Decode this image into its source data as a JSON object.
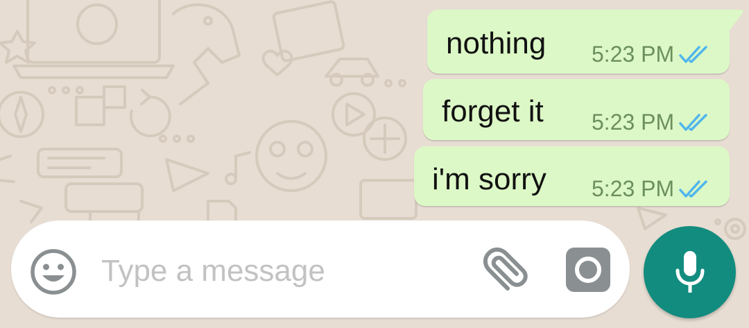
{
  "chat": {
    "messages": [
      {
        "text": "nothing",
        "time": "5:23 PM",
        "status": "read"
      },
      {
        "text": "forget it",
        "time": "5:23 PM",
        "status": "read"
      },
      {
        "text": "i'm sorry",
        "time": "5:23 PM",
        "status": "read"
      }
    ]
  },
  "composer": {
    "placeholder": "Type a message",
    "emoji_icon": "emoji-smiley-icon",
    "attach_icon": "paperclip-icon",
    "camera_icon": "camera-icon",
    "mic_icon": "microphone-icon"
  },
  "colors": {
    "wallpaper": "#e7ddd3",
    "outgoing_bubble": "#dcf8c6",
    "timestamp": "#6b8f5e",
    "read_ticks": "#4fb6ec",
    "accent": "#128c7e"
  }
}
